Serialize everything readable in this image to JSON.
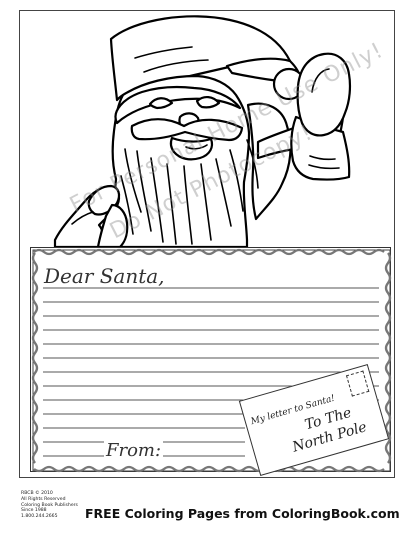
{
  "watermark": {
    "line1": "For Personal Home Use Only!",
    "line2": "Do Not Photocopy!"
  },
  "letter": {
    "greeting": "Dear Santa,",
    "from_label": "From:"
  },
  "envelope": {
    "line1": "My letter to Santa!",
    "line2": "To The",
    "line3": "North Pole"
  },
  "footer": {
    "copyright_lines": [
      "RBCB © 2010",
      "All Rights Reserved",
      "Coloring Book Publishers",
      "Since 1988",
      "1.800.244.2665"
    ],
    "main_text": "FREE Coloring Pages from ColoringBook.com"
  }
}
